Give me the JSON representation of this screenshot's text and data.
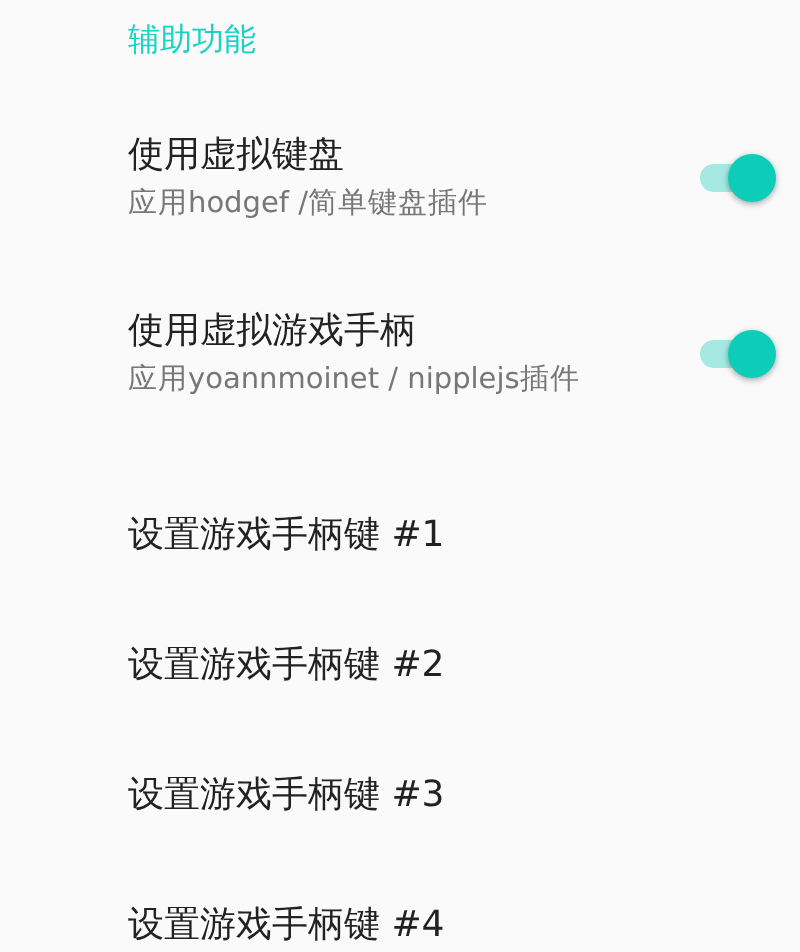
{
  "section_title": "辅助功能",
  "settings": [
    {
      "kind": "switch",
      "title": "使用虚拟键盘",
      "summary": "应用hodgef /简单键盘插件",
      "on": true
    },
    {
      "kind": "switch",
      "title": "使用虚拟游戏手柄",
      "summary": "应用yoannmoinet / nipplejs插件",
      "on": true
    },
    {
      "kind": "action",
      "title": "设置游戏手柄键 #1"
    },
    {
      "kind": "action",
      "title": "设置游戏手柄键 #2"
    },
    {
      "kind": "action",
      "title": "设置游戏手柄键 #3"
    },
    {
      "kind": "action",
      "title": "设置游戏手柄键 #4"
    }
  ]
}
